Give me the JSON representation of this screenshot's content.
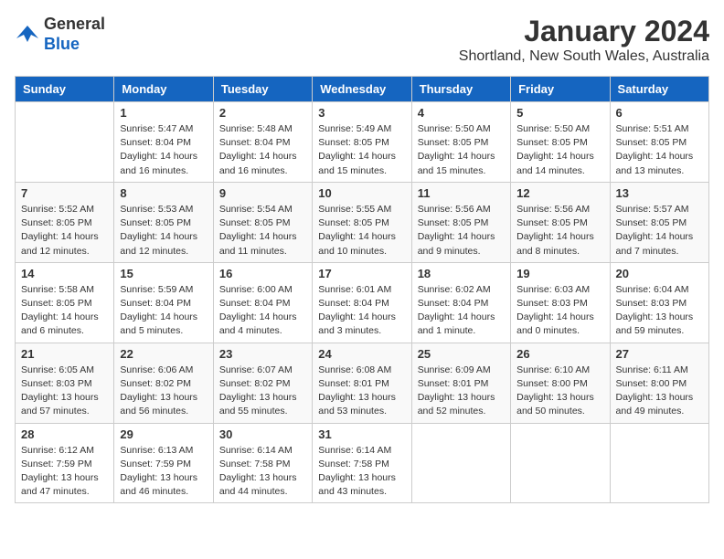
{
  "header": {
    "logo_general": "General",
    "logo_blue": "Blue",
    "title": "January 2024",
    "subtitle": "Shortland, New South Wales, Australia"
  },
  "days_of_week": [
    "Sunday",
    "Monday",
    "Tuesday",
    "Wednesday",
    "Thursday",
    "Friday",
    "Saturday"
  ],
  "weeks": [
    [
      {
        "num": "",
        "info": ""
      },
      {
        "num": "1",
        "info": "Sunrise: 5:47 AM\nSunset: 8:04 PM\nDaylight: 14 hours\nand 16 minutes."
      },
      {
        "num": "2",
        "info": "Sunrise: 5:48 AM\nSunset: 8:04 PM\nDaylight: 14 hours\nand 16 minutes."
      },
      {
        "num": "3",
        "info": "Sunrise: 5:49 AM\nSunset: 8:05 PM\nDaylight: 14 hours\nand 15 minutes."
      },
      {
        "num": "4",
        "info": "Sunrise: 5:50 AM\nSunset: 8:05 PM\nDaylight: 14 hours\nand 15 minutes."
      },
      {
        "num": "5",
        "info": "Sunrise: 5:50 AM\nSunset: 8:05 PM\nDaylight: 14 hours\nand 14 minutes."
      },
      {
        "num": "6",
        "info": "Sunrise: 5:51 AM\nSunset: 8:05 PM\nDaylight: 14 hours\nand 13 minutes."
      }
    ],
    [
      {
        "num": "7",
        "info": "Sunrise: 5:52 AM\nSunset: 8:05 PM\nDaylight: 14 hours\nand 12 minutes."
      },
      {
        "num": "8",
        "info": "Sunrise: 5:53 AM\nSunset: 8:05 PM\nDaylight: 14 hours\nand 12 minutes."
      },
      {
        "num": "9",
        "info": "Sunrise: 5:54 AM\nSunset: 8:05 PM\nDaylight: 14 hours\nand 11 minutes."
      },
      {
        "num": "10",
        "info": "Sunrise: 5:55 AM\nSunset: 8:05 PM\nDaylight: 14 hours\nand 10 minutes."
      },
      {
        "num": "11",
        "info": "Sunrise: 5:56 AM\nSunset: 8:05 PM\nDaylight: 14 hours\nand 9 minutes."
      },
      {
        "num": "12",
        "info": "Sunrise: 5:56 AM\nSunset: 8:05 PM\nDaylight: 14 hours\nand 8 minutes."
      },
      {
        "num": "13",
        "info": "Sunrise: 5:57 AM\nSunset: 8:05 PM\nDaylight: 14 hours\nand 7 minutes."
      }
    ],
    [
      {
        "num": "14",
        "info": "Sunrise: 5:58 AM\nSunset: 8:05 PM\nDaylight: 14 hours\nand 6 minutes."
      },
      {
        "num": "15",
        "info": "Sunrise: 5:59 AM\nSunset: 8:04 PM\nDaylight: 14 hours\nand 5 minutes."
      },
      {
        "num": "16",
        "info": "Sunrise: 6:00 AM\nSunset: 8:04 PM\nDaylight: 14 hours\nand 4 minutes."
      },
      {
        "num": "17",
        "info": "Sunrise: 6:01 AM\nSunset: 8:04 PM\nDaylight: 14 hours\nand 3 minutes."
      },
      {
        "num": "18",
        "info": "Sunrise: 6:02 AM\nSunset: 8:04 PM\nDaylight: 14 hours\nand 1 minute."
      },
      {
        "num": "19",
        "info": "Sunrise: 6:03 AM\nSunset: 8:03 PM\nDaylight: 14 hours\nand 0 minutes."
      },
      {
        "num": "20",
        "info": "Sunrise: 6:04 AM\nSunset: 8:03 PM\nDaylight: 13 hours\nand 59 minutes."
      }
    ],
    [
      {
        "num": "21",
        "info": "Sunrise: 6:05 AM\nSunset: 8:03 PM\nDaylight: 13 hours\nand 57 minutes."
      },
      {
        "num": "22",
        "info": "Sunrise: 6:06 AM\nSunset: 8:02 PM\nDaylight: 13 hours\nand 56 minutes."
      },
      {
        "num": "23",
        "info": "Sunrise: 6:07 AM\nSunset: 8:02 PM\nDaylight: 13 hours\nand 55 minutes."
      },
      {
        "num": "24",
        "info": "Sunrise: 6:08 AM\nSunset: 8:01 PM\nDaylight: 13 hours\nand 53 minutes."
      },
      {
        "num": "25",
        "info": "Sunrise: 6:09 AM\nSunset: 8:01 PM\nDaylight: 13 hours\nand 52 minutes."
      },
      {
        "num": "26",
        "info": "Sunrise: 6:10 AM\nSunset: 8:00 PM\nDaylight: 13 hours\nand 50 minutes."
      },
      {
        "num": "27",
        "info": "Sunrise: 6:11 AM\nSunset: 8:00 PM\nDaylight: 13 hours\nand 49 minutes."
      }
    ],
    [
      {
        "num": "28",
        "info": "Sunrise: 6:12 AM\nSunset: 7:59 PM\nDaylight: 13 hours\nand 47 minutes."
      },
      {
        "num": "29",
        "info": "Sunrise: 6:13 AM\nSunset: 7:59 PM\nDaylight: 13 hours\nand 46 minutes."
      },
      {
        "num": "30",
        "info": "Sunrise: 6:14 AM\nSunset: 7:58 PM\nDaylight: 13 hours\nand 44 minutes."
      },
      {
        "num": "31",
        "info": "Sunrise: 6:14 AM\nSunset: 7:58 PM\nDaylight: 13 hours\nand 43 minutes."
      },
      {
        "num": "",
        "info": ""
      },
      {
        "num": "",
        "info": ""
      },
      {
        "num": "",
        "info": ""
      }
    ]
  ]
}
